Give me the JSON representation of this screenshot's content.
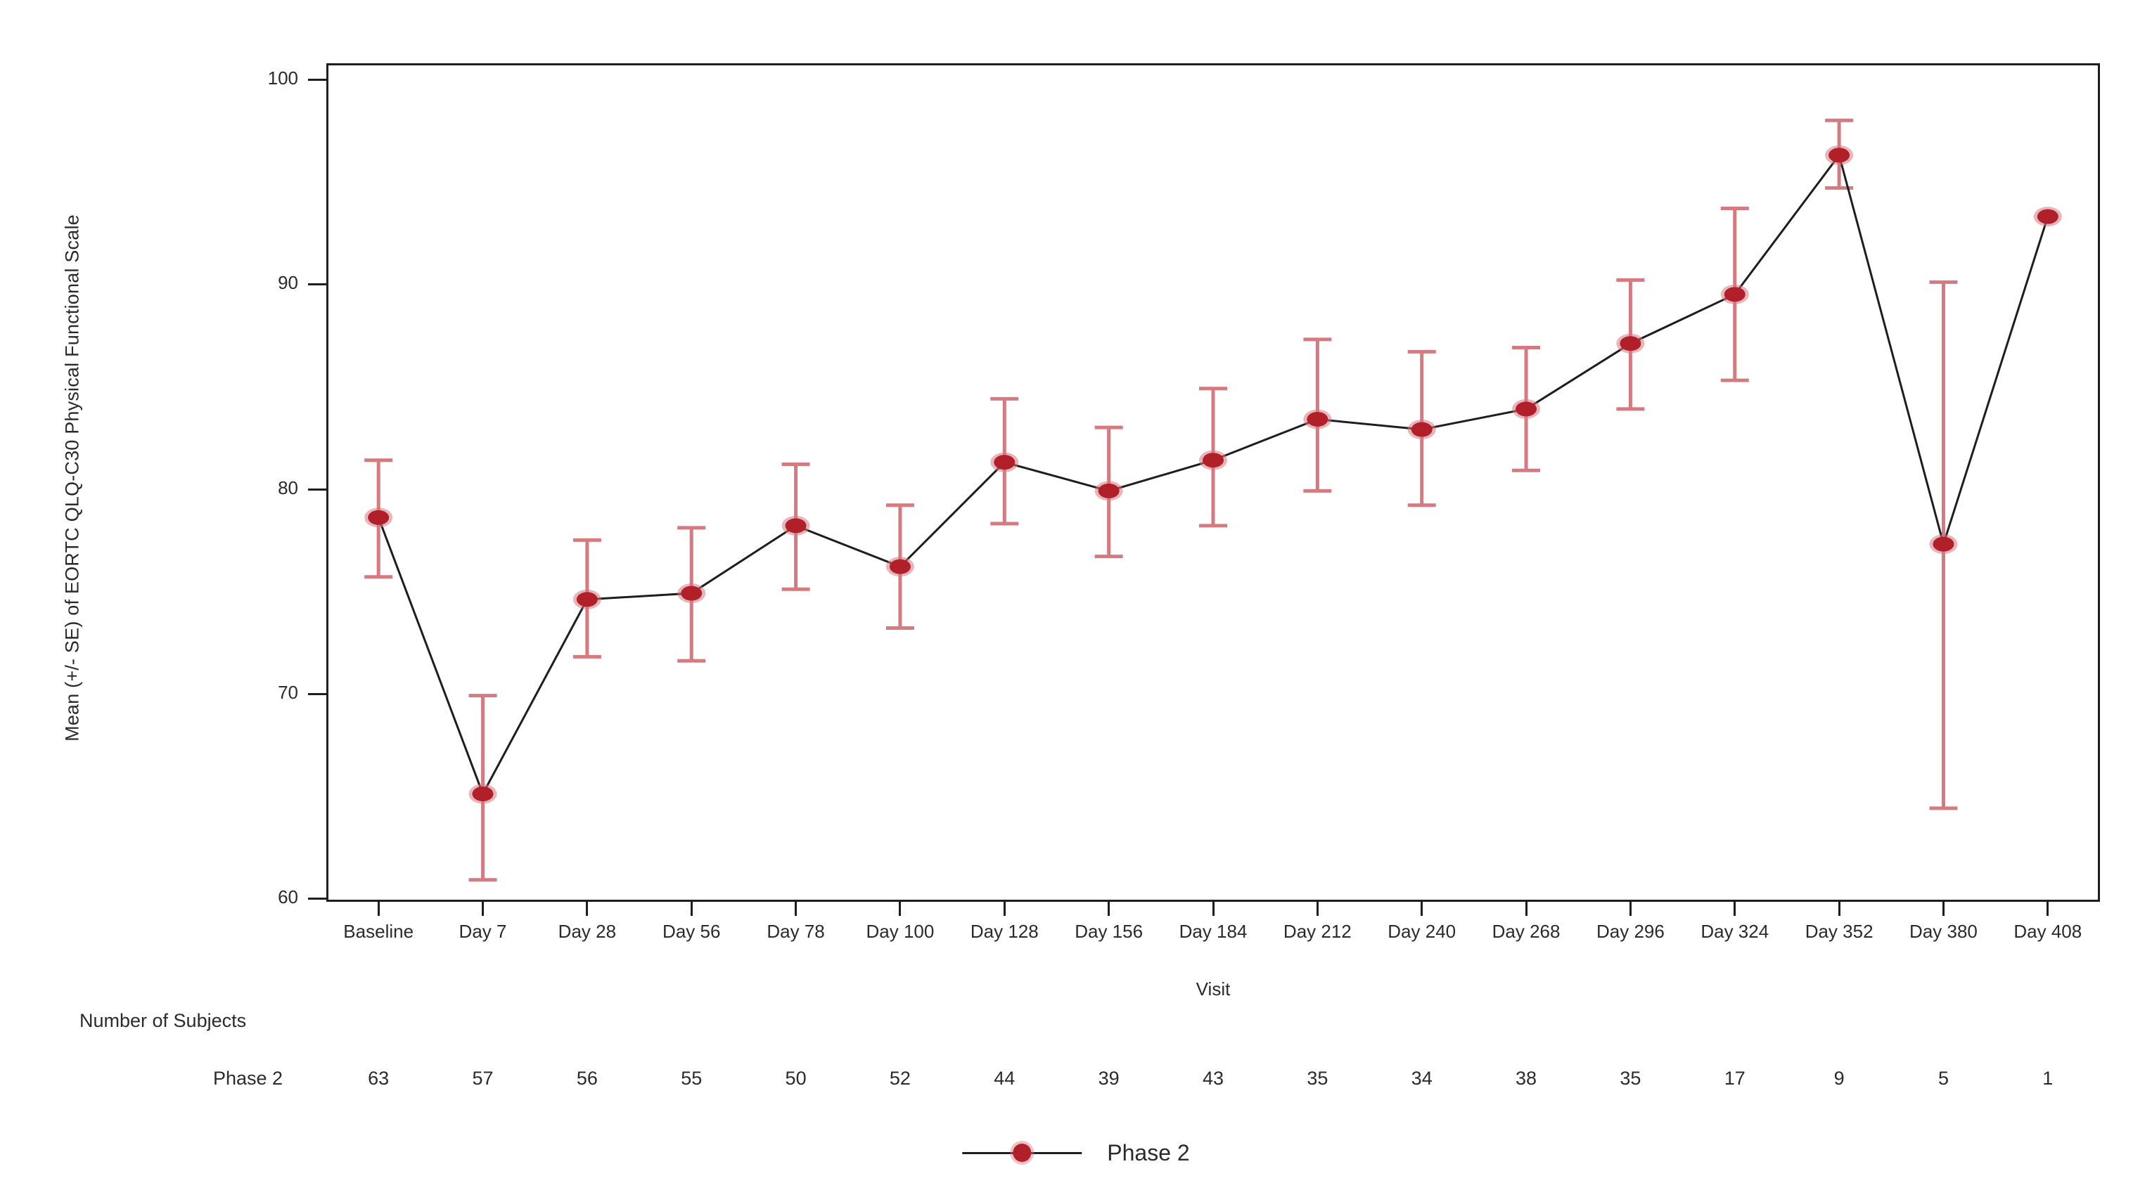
{
  "chart_data": {
    "type": "line",
    "title": "",
    "xlabel": "Visit",
    "ylabel": "Mean (+/- SE) of EORTC QLQ-C30 Physical Functional Scale",
    "ylim": [
      60,
      100
    ],
    "yticks": [
      60,
      70,
      80,
      90,
      100
    ],
    "grid": false,
    "legend_position": "bottom-center",
    "categories": [
      "Baseline",
      "Day 7",
      "Day 28",
      "Day 56",
      "Day 78",
      "Day 100",
      "Day 128",
      "Day 156",
      "Day 184",
      "Day 212",
      "Day 240",
      "Day 268",
      "Day 296",
      "Day 324",
      "Day 352",
      "Day 380",
      "Day 408"
    ],
    "series": [
      {
        "name": "Phase 2",
        "color": "#b12028",
        "errorbar_color": "#d67a82",
        "line_color": "#1e1e1e",
        "values": [
          78.6,
          65.1,
          74.6,
          74.9,
          78.2,
          76.2,
          81.3,
          79.9,
          81.4,
          83.4,
          82.9,
          83.9,
          87.1,
          89.5,
          96.3,
          77.3,
          93.3
        ],
        "error_upper": [
          81.4,
          69.9,
          77.5,
          78.1,
          81.2,
          79.2,
          84.4,
          83.0,
          84.9,
          87.3,
          86.7,
          86.9,
          90.2,
          93.7,
          98.0,
          90.1,
          null
        ],
        "error_lower": [
          75.7,
          60.9,
          71.8,
          71.6,
          75.1,
          73.2,
          78.3,
          76.7,
          78.2,
          79.9,
          79.2,
          80.9,
          83.9,
          85.3,
          94.7,
          64.4,
          null
        ]
      }
    ]
  },
  "subject_counts": {
    "title": "Number of Subjects",
    "row_label": "Phase 2",
    "values": [
      63,
      57,
      56,
      55,
      50,
      52,
      44,
      39,
      43,
      35,
      34,
      38,
      35,
      17,
      9,
      5,
      1
    ]
  },
  "legend": {
    "entries": [
      {
        "label": "Phase 2",
        "marker_color": "#b12028",
        "line_color": "#1e1e1e"
      }
    ]
  },
  "colors": {
    "marker": "#b12028",
    "errorbar": "#d67a82",
    "line": "#1e1e1e",
    "axis": "#1e1e1e",
    "text": "#2b2b2b",
    "background": "#ffffff"
  }
}
